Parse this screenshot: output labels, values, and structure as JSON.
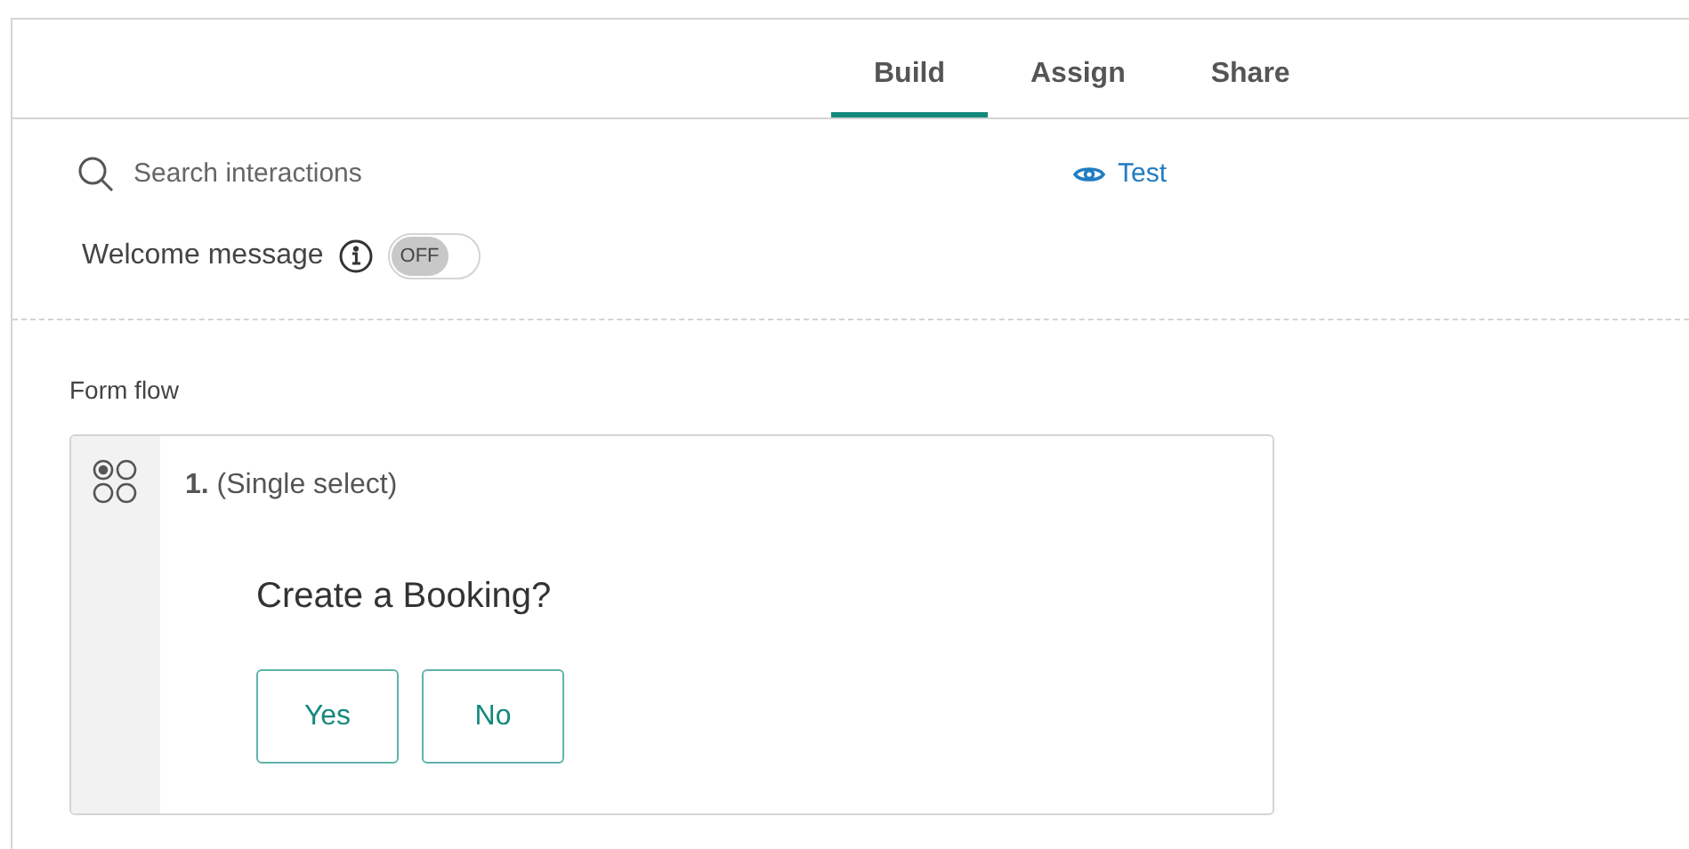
{
  "tabs": [
    {
      "label": "Build",
      "selected": true
    },
    {
      "label": "Assign",
      "selected": false
    },
    {
      "label": "Share",
      "selected": false
    }
  ],
  "search": {
    "placeholder": "Search interactions"
  },
  "test_link": "Test",
  "welcome_message": {
    "label": "Welcome message",
    "on": false,
    "toggle_text": "OFF"
  },
  "form_flow": {
    "title": "Form flow",
    "items": [
      {
        "heading": "**1.** (Single select)",
        "question": "Create a Booking?",
        "options": [
          "Yes",
          "No"
        ]
      }
    ]
  }
}
